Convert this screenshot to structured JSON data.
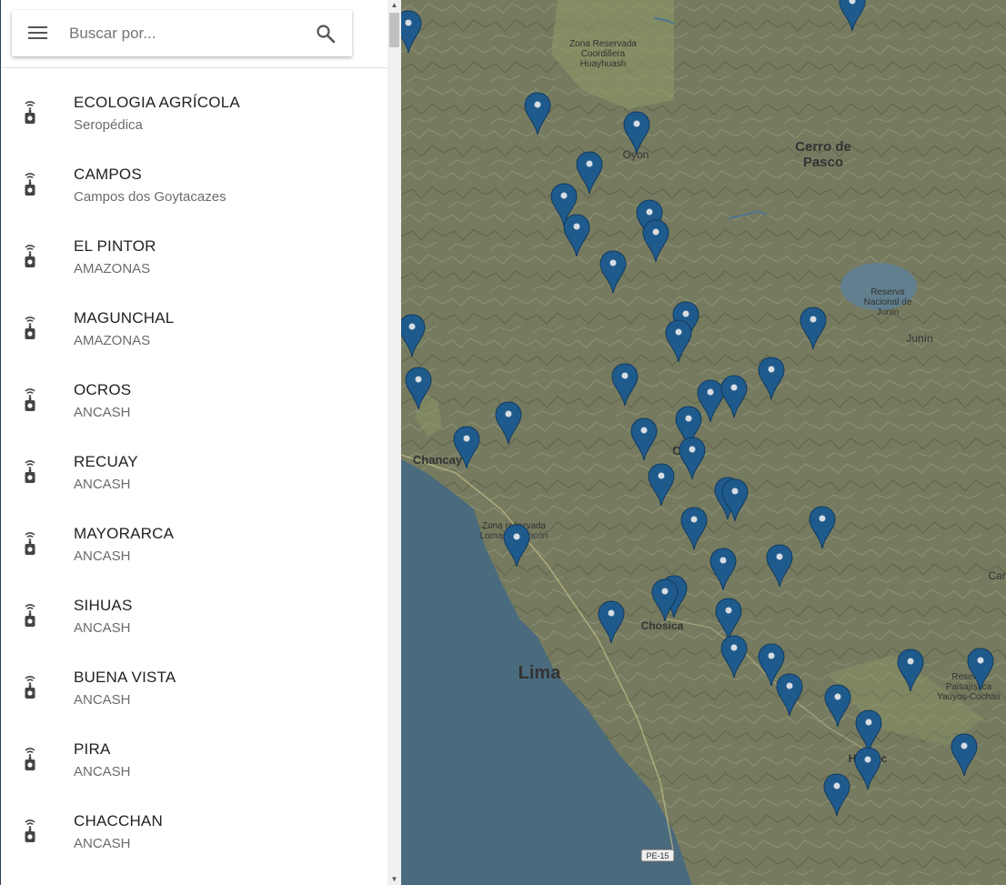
{
  "search": {
    "placeholder": "Buscar por..."
  },
  "stations": [
    {
      "name": "ECOLOGIA AGRÍCOLA",
      "region": "Seropédica"
    },
    {
      "name": "CAMPOS",
      "region": "Campos dos Goytacazes"
    },
    {
      "name": "EL PINTOR",
      "region": "AMAZONAS"
    },
    {
      "name": "MAGUNCHAL",
      "region": "AMAZONAS"
    },
    {
      "name": "OCROS",
      "region": "ANCASH"
    },
    {
      "name": "RECUAY",
      "region": "ANCASH"
    },
    {
      "name": "MAYORARCA",
      "region": "ANCASH"
    },
    {
      "name": "SIHUAS",
      "region": "ANCASH"
    },
    {
      "name": "BUENA VISTA",
      "region": "ANCASH"
    },
    {
      "name": "PIRA",
      "region": "ANCASH"
    },
    {
      "name": "CHACCHAN",
      "region": "ANCASH"
    }
  ],
  "map": {
    "labels": {
      "zona_huayhuash": [
        "Zona Reservada",
        "Coordillera",
        "Huayhuash"
      ],
      "oyon": "Oyon",
      "cerro_de_pasco": [
        "Cerro de",
        "Pasco"
      ],
      "reserva_junin": [
        "Reserva",
        "Nacional de",
        "Junín"
      ],
      "junin": "Junín",
      "chancay": "Chancay",
      "c_partial": "C",
      "zona_lomas": [
        "Zona reservada",
        "Lomas de Ancón"
      ],
      "chosica": "Chosica",
      "car": "Car",
      "lima": "Lima",
      "reserva_yauyos": [
        "Reserva",
        "Paisajística",
        "Yauyos-Cochas"
      ],
      "huancayo_partial": "Hu    ec",
      "pe15": "PE-15"
    },
    "marker_color": "#1f5a8c"
  }
}
